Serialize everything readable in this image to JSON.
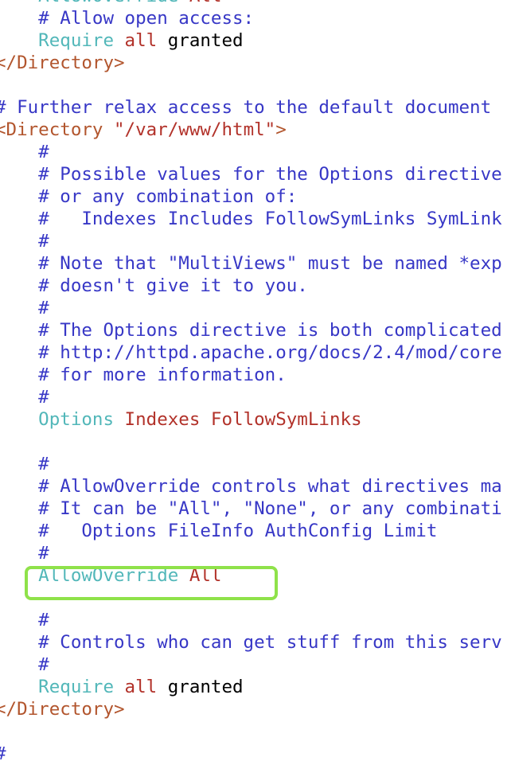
{
  "colors": {
    "comment": "#3737c6",
    "tag": "#b2552d",
    "string": "#b2322a",
    "directive": "#52b7b9",
    "value": "#b2322a",
    "plain": "#000000",
    "highlight_box": "#8fe24a",
    "background": "#ffffff"
  },
  "code_lines": [
    {
      "segments": [
        {
          "text": "    AllowOverride ",
          "type": "directive"
        },
        {
          "text": "All",
          "type": "value"
        }
      ]
    },
    {
      "segments": [
        {
          "text": "    # Allow open access:",
          "type": "comment"
        }
      ]
    },
    {
      "segments": [
        {
          "text": "    Require",
          "type": "directive"
        },
        {
          "text": " all",
          "type": "value"
        },
        {
          "text": " granted",
          "type": "plain"
        }
      ]
    },
    {
      "segments": [
        {
          "text": "</Directory>",
          "type": "tag"
        }
      ]
    },
    {
      "segments": []
    },
    {
      "segments": [
        {
          "text": "# Further relax access to the default document",
          "type": "comment"
        }
      ]
    },
    {
      "segments": [
        {
          "text": "<Directory ",
          "type": "tag"
        },
        {
          "text": "\"/var/www/html\"",
          "type": "string"
        },
        {
          "text": ">",
          "type": "tag"
        }
      ]
    },
    {
      "segments": [
        {
          "text": "    #",
          "type": "comment"
        }
      ]
    },
    {
      "segments": [
        {
          "text": "    # Possible values for the Options directive",
          "type": "comment"
        }
      ]
    },
    {
      "segments": [
        {
          "text": "    # or any combination of:",
          "type": "comment"
        }
      ]
    },
    {
      "segments": [
        {
          "text": "    #   Indexes Includes FollowSymLinks SymLink",
          "type": "comment"
        }
      ]
    },
    {
      "segments": [
        {
          "text": "    #",
          "type": "comment"
        }
      ]
    },
    {
      "segments": [
        {
          "text": "    # Note that \"MultiViews\" must be named *exp",
          "type": "comment"
        }
      ]
    },
    {
      "segments": [
        {
          "text": "    # doesn't give it to you.",
          "type": "comment"
        }
      ]
    },
    {
      "segments": [
        {
          "text": "    #",
          "type": "comment"
        }
      ]
    },
    {
      "segments": [
        {
          "text": "    # The Options directive is both complicated",
          "type": "comment"
        }
      ]
    },
    {
      "segments": [
        {
          "text": "    # http://httpd.apache.org/docs/2.4/mod/core",
          "type": "comment"
        }
      ]
    },
    {
      "segments": [
        {
          "text": "    # for more information.",
          "type": "comment"
        }
      ]
    },
    {
      "segments": [
        {
          "text": "    #",
          "type": "comment"
        }
      ]
    },
    {
      "segments": [
        {
          "text": "    Options",
          "type": "directive"
        },
        {
          "text": " Indexes FollowSymLinks",
          "type": "value"
        }
      ]
    },
    {
      "segments": []
    },
    {
      "segments": [
        {
          "text": "    #",
          "type": "comment"
        }
      ]
    },
    {
      "segments": [
        {
          "text": "    # AllowOverride controls what directives ma",
          "type": "comment"
        }
      ]
    },
    {
      "segments": [
        {
          "text": "    # It can be \"All\", \"None\", or any combinati",
          "type": "comment"
        }
      ]
    },
    {
      "segments": [
        {
          "text": "    #   Options FileInfo AuthConfig Limit",
          "type": "comment"
        }
      ]
    },
    {
      "segments": [
        {
          "text": "    #",
          "type": "comment"
        }
      ]
    },
    {
      "segments": [
        {
          "text": "    AllowOverride",
          "type": "directive"
        },
        {
          "text": " All",
          "type": "value"
        }
      ]
    },
    {
      "segments": []
    },
    {
      "segments": [
        {
          "text": "    #",
          "type": "comment"
        }
      ]
    },
    {
      "segments": [
        {
          "text": "    # Controls who can get stuff from this serv",
          "type": "comment"
        }
      ]
    },
    {
      "segments": [
        {
          "text": "    #",
          "type": "comment"
        }
      ]
    },
    {
      "segments": [
        {
          "text": "    Require",
          "type": "directive"
        },
        {
          "text": " all",
          "type": "value"
        },
        {
          "text": " granted",
          "type": "plain"
        }
      ]
    },
    {
      "segments": [
        {
          "text": "</Directory>",
          "type": "tag"
        }
      ]
    },
    {
      "segments": []
    },
    {
      "segments": [
        {
          "text": "#",
          "type": "comment"
        }
      ]
    }
  ]
}
